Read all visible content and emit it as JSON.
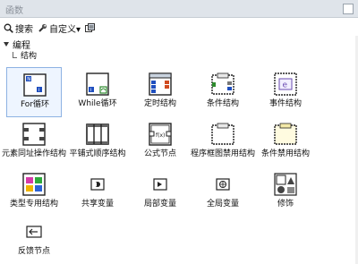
{
  "window": {
    "title": "函数"
  },
  "toolbar": {
    "search_label": "搜索",
    "customize_label": "自定义▾"
  },
  "breadcrumb": {
    "level1": "编程",
    "level2": "结构"
  },
  "palette": {
    "items": [
      {
        "label": "For循环",
        "icon": "for-loop-icon"
      },
      {
        "label": "While循环",
        "icon": "while-loop-icon"
      },
      {
        "label": "定时结构",
        "icon": "timed-structure-icon"
      },
      {
        "label": "条件结构",
        "icon": "case-structure-icon"
      },
      {
        "label": "事件结构",
        "icon": "event-structure-icon"
      },
      {
        "label": "元素同址操作结构",
        "icon": "in-place-element-icon"
      },
      {
        "label": "平铺式顺序结构",
        "icon": "flat-sequence-icon"
      },
      {
        "label": "公式节点",
        "icon": "formula-node-icon"
      },
      {
        "label": "程序框图禁用结构",
        "icon": "diagram-disable-icon"
      },
      {
        "label": "条件禁用结构",
        "icon": "conditional-disable-icon"
      },
      {
        "label": "类型专用结构",
        "icon": "type-specialization-icon"
      },
      {
        "label": "共享变量",
        "icon": "shared-variable-icon"
      },
      {
        "label": "局部变量",
        "icon": "local-variable-icon"
      },
      {
        "label": "全局变量",
        "icon": "global-variable-icon"
      },
      {
        "label": "修饰",
        "icon": "decorations-icon"
      },
      {
        "label": "反馈节点",
        "icon": "feedback-node-icon"
      }
    ]
  }
}
